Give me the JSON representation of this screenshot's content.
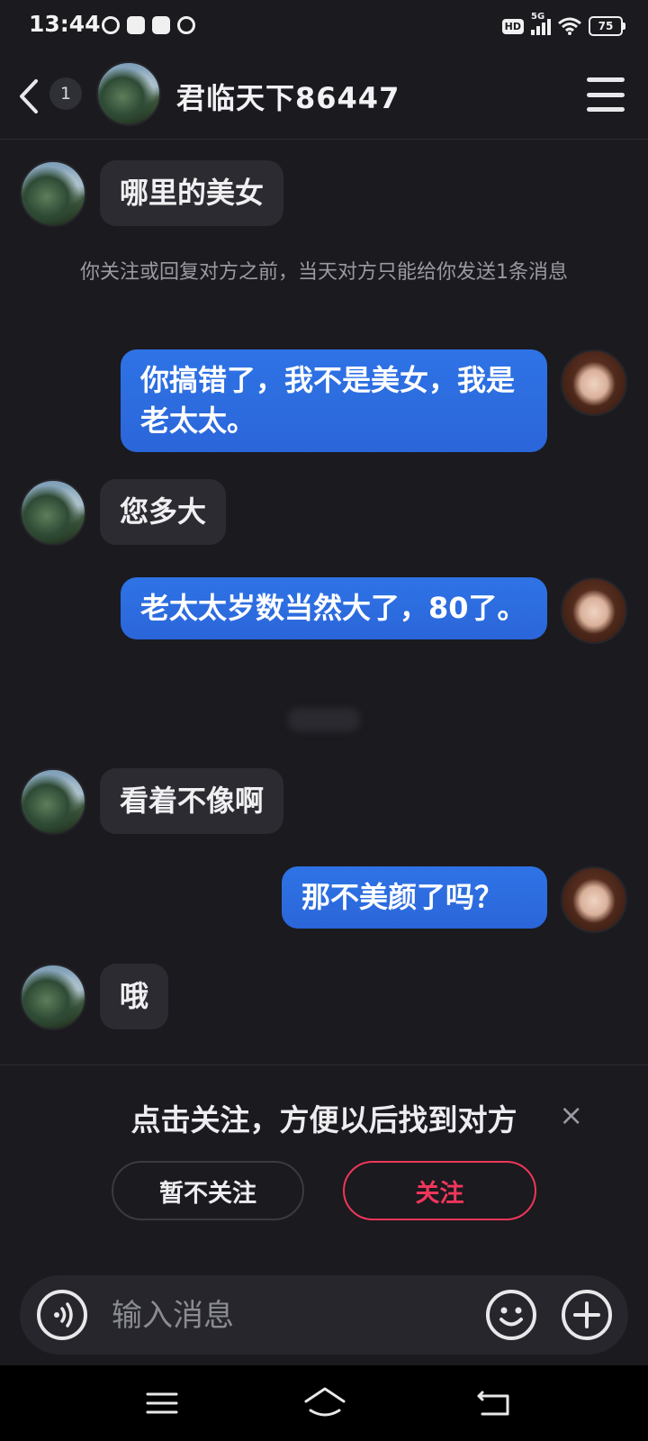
{
  "status_bar": {
    "time": "13:44",
    "network_label": "5G",
    "hd_label": "HD",
    "battery": "75"
  },
  "header": {
    "unread_count": "1",
    "contact_name": "君临天下86447"
  },
  "messages": [
    {
      "direction": "incoming",
      "text": "哪里的美女"
    },
    {
      "direction": "outgoing",
      "text": "你搞错了，我不是美女，我是老太太。"
    },
    {
      "direction": "incoming",
      "text": "您多大"
    },
    {
      "direction": "outgoing",
      "text": "老太太岁数当然大了，80了。"
    },
    {
      "direction": "incoming",
      "text": "看着不像啊"
    },
    {
      "direction": "outgoing",
      "text": "那不美颜了吗？"
    },
    {
      "direction": "incoming",
      "text": "哦"
    }
  ],
  "system_tip": "你关注或回复对方之前，当天对方只能给你发送1条消息",
  "follow_prompt": {
    "text": "点击关注，方便以后找到对方",
    "close_icon": "×",
    "later_label": "暂不关注",
    "follow_label": "关注",
    "follow_color": "#f0365a"
  },
  "input": {
    "placeholder": "输入消息"
  },
  "colors": {
    "outgoing_bubble": "#2e73e6",
    "incoming_bubble": "#2b2b31",
    "background": "#1a1a1f"
  },
  "icons": [
    "back-arrow-icon",
    "menu-icon",
    "voice-icon",
    "emoji-icon",
    "plus-icon",
    "nav-menu-icon",
    "nav-home-icon",
    "nav-back-icon"
  ]
}
